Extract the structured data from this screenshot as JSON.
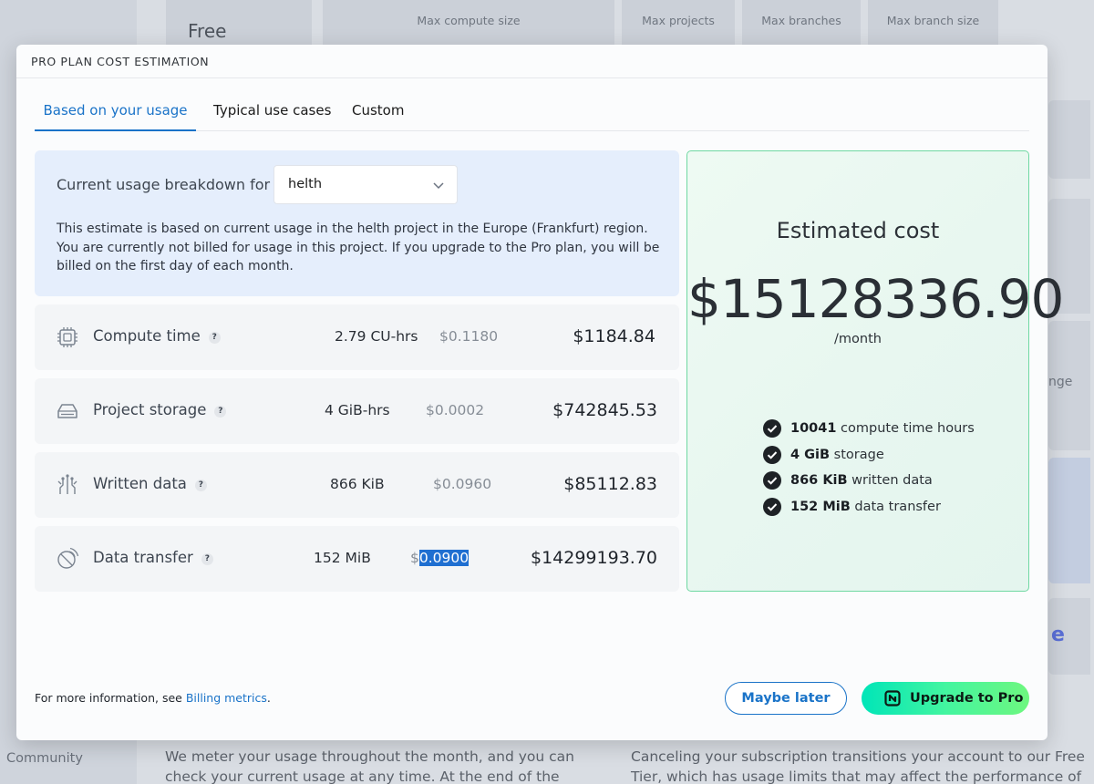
{
  "background": {
    "plan_name": "Free",
    "column_headers": [
      "Max compute size",
      "Max projects",
      "Max branches",
      "Max branch size"
    ],
    "sidebar_item": "Community",
    "right_fragments": [
      "nge",
      "e"
    ],
    "paragraph_left": "We meter your usage throughout the month, and you can check your current usage at any time. At the end of the month, your card is charged",
    "paragraph_right": "Canceling your subscription transitions your account to our Free Tier, which has usage limits that may affect the performance of your applications. The"
  },
  "modal": {
    "title": "PRO PLAN COST ESTIMATION",
    "tabs": [
      {
        "label": "Based on your usage",
        "active": true
      },
      {
        "label": "Typical use cases",
        "active": false
      },
      {
        "label": "Custom",
        "active": false
      }
    ],
    "usage": {
      "label": "Current usage breakdown for",
      "selected_project": "helth",
      "description": "This estimate is based on current usage in the helth project in the Europe (Frankfurt) region. You are currently not billed for usage in this project. If you upgrade to the Pro plan, you will be billed on the first day of each month."
    },
    "rows": [
      {
        "icon": "chip-icon",
        "name": "Compute time",
        "help": "?",
        "quantity": "2.79 CU-hrs",
        "rate": "$0.1180",
        "total": "$1184.84"
      },
      {
        "icon": "storage-icon",
        "name": "Project storage",
        "help": "?",
        "quantity": "4 GiB-hrs",
        "rate": "$0.0002",
        "total": "$742845.53"
      },
      {
        "icon": "circuit-icon",
        "name": "Written data",
        "help": "?",
        "quantity": "866 KiB",
        "rate": "$0.0960",
        "total": "$85112.83"
      },
      {
        "icon": "satellite-icon",
        "name": "Data transfer",
        "help": "?",
        "quantity": "152 MiB",
        "rate_prefix": "$",
        "rate_selected": "0.0900",
        "total": "$14299193.70"
      }
    ],
    "estimate": {
      "title": "Estimated cost",
      "value": "$15128336.90",
      "period": "/month",
      "items": [
        {
          "bold": "10041",
          "text": " compute time hours"
        },
        {
          "bold": "4 GiB",
          "text": " storage"
        },
        {
          "bold": "866 KiB",
          "text": " written data"
        },
        {
          "bold": "152 MiB",
          "text": " data transfer"
        }
      ]
    },
    "footer": {
      "info_prefix": "For more information, see ",
      "info_link": "Billing metrics",
      "info_suffix": ".",
      "maybe_later": "Maybe later",
      "upgrade": "Upgrade to Pro"
    }
  },
  "colors": {
    "accent": "#1a73c8",
    "usage_box_bg": "#e5eefc",
    "cost_panel_border": "#6fd8a2",
    "upgrade_gradient_start": "#00e5b8",
    "upgrade_gradient_end": "#6ef77f",
    "selection": "#1f6fd1"
  }
}
